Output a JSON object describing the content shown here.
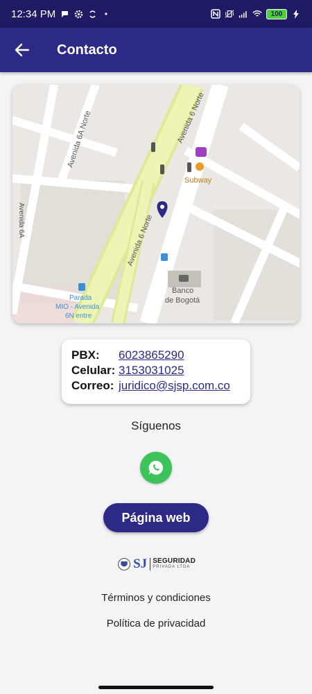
{
  "status_bar": {
    "time": "12:34 PM",
    "battery": "100"
  },
  "app_bar": {
    "title": "Contacto",
    "back_icon": "arrow-left-icon"
  },
  "map": {
    "streets": [
      "Avenida 6 Norte",
      "Avenida 6 Norte",
      "Avenida 6A Norte",
      "Avenida 6A"
    ],
    "places": [
      "Subway",
      "Banco",
      "de Bogotá",
      "Parada",
      "MIO - Avenida",
      "6N entre"
    ]
  },
  "contact": {
    "pbx_label": "PBX:",
    "pbx_value": "6023865290",
    "cel_label": "Celular:",
    "cel_value": "3153031025",
    "mail_label": "Correo:",
    "mail_value": "juridico@sjsp.com.co"
  },
  "follow": {
    "label": "Síguenos",
    "whatsapp_icon": "whatsapp-icon"
  },
  "web_button": {
    "label": "Página web"
  },
  "logo": {
    "sj": "SJ",
    "main": "SEGURIDAD",
    "sub": "PRIVADA LTDA"
  },
  "links": {
    "terms": "Términos y condiciones",
    "privacy": "Política de privacidad"
  },
  "colors": {
    "primary": "#2c2a86",
    "status": "#1e1a64",
    "whatsapp": "#3cc35a",
    "avenue": "#e8f2a8"
  }
}
